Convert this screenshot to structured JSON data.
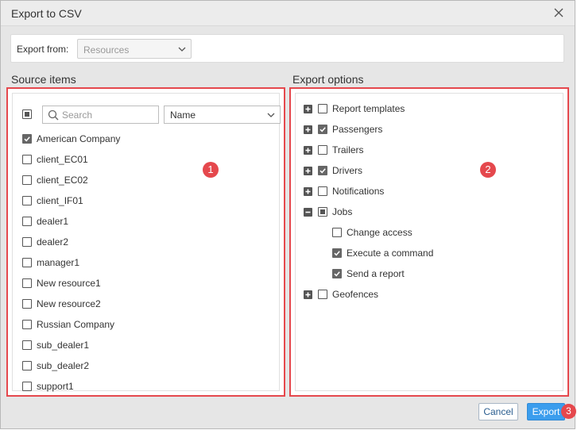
{
  "dialog": {
    "title": "Export to CSV"
  },
  "export_from": {
    "label": "Export from:",
    "value": "Resources"
  },
  "source": {
    "title": "Source items",
    "search_placeholder": "Search",
    "sort_value": "Name",
    "items": [
      {
        "label": "American Company",
        "checked": true
      },
      {
        "label": "client_EC01",
        "checked": false
      },
      {
        "label": "client_EC02",
        "checked": false
      },
      {
        "label": "client_IF01",
        "checked": false
      },
      {
        "label": "dealer1",
        "checked": false
      },
      {
        "label": "dealer2",
        "checked": false
      },
      {
        "label": "manager1",
        "checked": false
      },
      {
        "label": "New resource1",
        "checked": false
      },
      {
        "label": "New resource2",
        "checked": false
      },
      {
        "label": "Russian Company",
        "checked": false
      },
      {
        "label": "sub_dealer1",
        "checked": false
      },
      {
        "label": "sub_dealer2",
        "checked": false
      },
      {
        "label": "support1",
        "checked": false
      }
    ]
  },
  "options": {
    "title": "Export options",
    "items": [
      {
        "label": "Report templates",
        "state": "unchecked",
        "expander": "plus"
      },
      {
        "label": "Passengers",
        "state": "checked",
        "expander": "plus"
      },
      {
        "label": "Trailers",
        "state": "unchecked",
        "expander": "plus"
      },
      {
        "label": "Drivers",
        "state": "checked",
        "expander": "plus"
      },
      {
        "label": "Notifications",
        "state": "unchecked",
        "expander": "plus"
      },
      {
        "label": "Jobs",
        "state": "partial",
        "expander": "minus"
      },
      {
        "label": "Change access",
        "state": "unchecked",
        "child": true
      },
      {
        "label": "Execute a command",
        "state": "checked",
        "child": true
      },
      {
        "label": "Send a report",
        "state": "checked",
        "child": true
      },
      {
        "label": "Geofences",
        "state": "unchecked",
        "expander": "plus"
      }
    ]
  },
  "markers": {
    "m1": "1",
    "m2": "2",
    "m3": "3"
  },
  "buttons": {
    "cancel": "Cancel",
    "export": "Export"
  },
  "colors": {
    "highlight": "#e5484d",
    "primary": "#3b9ded"
  }
}
